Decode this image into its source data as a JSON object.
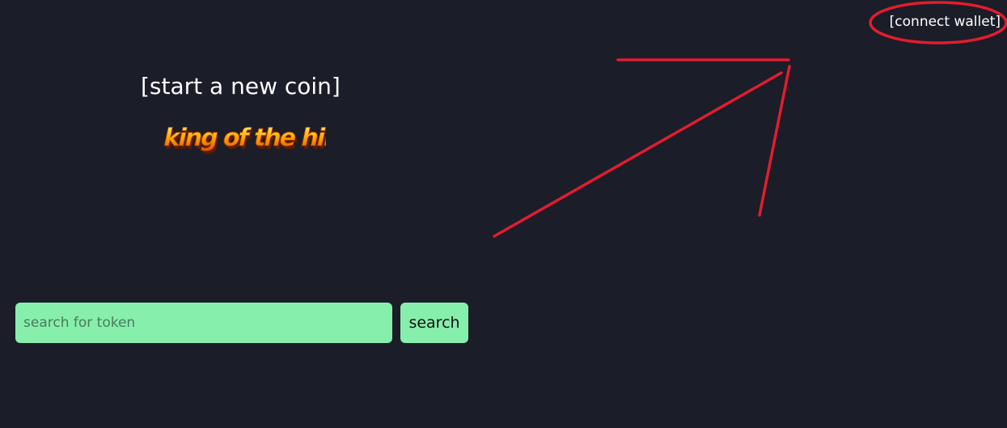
{
  "header": {
    "connect_wallet_label": "[connect wallet]"
  },
  "hero": {
    "start_coin_label": "[start a new coin]",
    "king_logo_text": "king of the hill"
  },
  "search": {
    "placeholder": "search for token",
    "value": "",
    "button_label": "search"
  },
  "colors": {
    "background": "#1b1d28",
    "accent_green": "#86efac",
    "annotation_red": "#e11d2e"
  }
}
